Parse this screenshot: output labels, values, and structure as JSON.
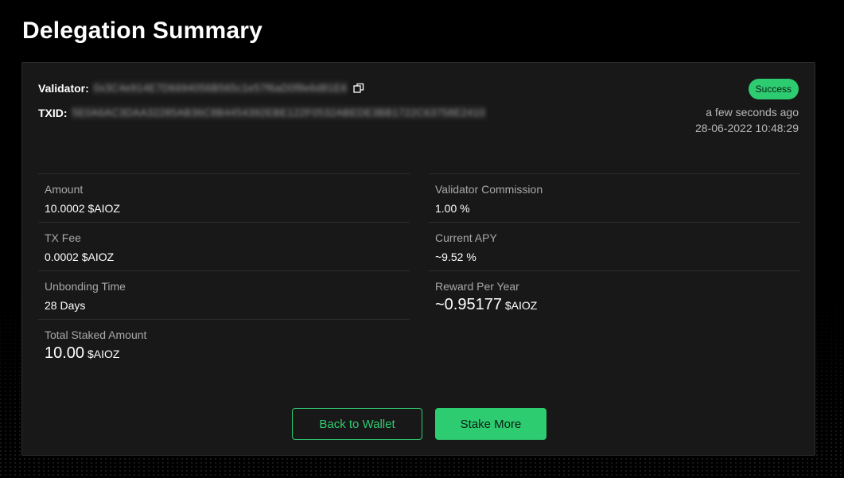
{
  "page": {
    "title": "Delegation Summary"
  },
  "transaction": {
    "validator_label": "Validator:",
    "validator_address": "0x3C4e914E7D6694056B565c1e57f6aD0f8e6d81E6",
    "txid_label": "TXID:",
    "txid_value": "5E0A6AC3DAA32285AB36C8B4454392EBE122F0532ABEDE3BB1722C63758E2410",
    "status": "Success",
    "time_relative": "a few seconds ago",
    "time_absolute": "28-06-2022 10:48:29"
  },
  "stats_left": [
    {
      "label": "Amount",
      "value": "10.0002 $AIOZ"
    },
    {
      "label": "TX Fee",
      "value": "0.0002 $AIOZ"
    },
    {
      "label": "Unbonding Time",
      "value": "28 Days"
    },
    {
      "label": "Total Staked Amount",
      "value_num": "10.00",
      "value_unit": "$AIOZ"
    }
  ],
  "stats_right": [
    {
      "label": "Validator Commission",
      "value": "1.00 %"
    },
    {
      "label": "Current APY",
      "value": "~9.52 %"
    },
    {
      "label": "Reward Per Year",
      "value_num": "~0.95177",
      "value_unit": "$AIOZ"
    }
  ],
  "actions": {
    "back_label": "Back to Wallet",
    "stake_label": "Stake More"
  },
  "icons": {
    "copy": "copy-icon"
  },
  "colors": {
    "accent": "#2ecc71",
    "background": "#000000",
    "card": "#181818"
  }
}
